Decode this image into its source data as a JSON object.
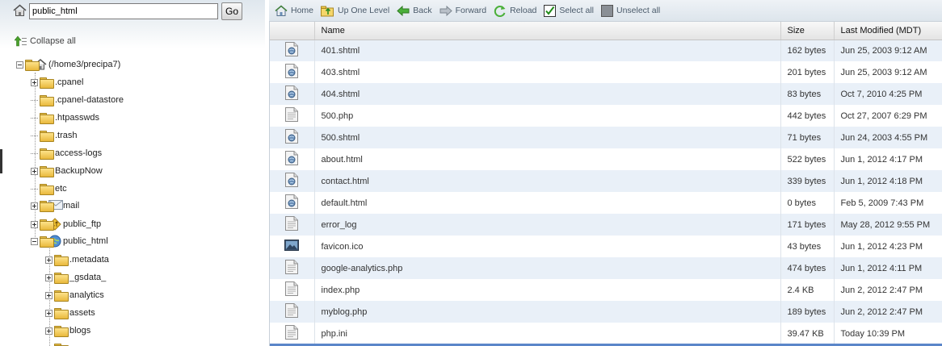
{
  "path_bar": {
    "value": "public_html",
    "go_label": "Go"
  },
  "tree": {
    "collapse_all": "Collapse all",
    "root": "(/home3/precipa7)",
    "items": [
      {
        "label": ".cpanel",
        "icon": "folder-icon",
        "expander": "plus"
      },
      {
        "label": ".cpanel-datastore",
        "icon": "folder-icon",
        "expander": "none"
      },
      {
        "label": ".htpasswds",
        "icon": "folder-icon",
        "expander": "none"
      },
      {
        "label": ".trash",
        "icon": "folder-icon",
        "expander": "none"
      },
      {
        "label": "access-logs",
        "icon": "folder-icon",
        "expander": "none"
      },
      {
        "label": "BackupNow",
        "icon": "folder-icon",
        "expander": "plus"
      },
      {
        "label": "etc",
        "icon": "folder-icon",
        "expander": "none"
      },
      {
        "label": "mail",
        "icon": "mail-folder-icon",
        "expander": "plus"
      },
      {
        "label": "public_ftp",
        "icon": "ftp-folder-icon",
        "expander": "plus"
      },
      {
        "label": "public_html",
        "icon": "web-folder-icon",
        "expander": "minus"
      }
    ],
    "sub_items": [
      {
        "label": ".metadata",
        "icon": "folder-icon",
        "expander": "plus"
      },
      {
        "label": "_gsdata_",
        "icon": "folder-icon",
        "expander": "plus"
      },
      {
        "label": "analytics",
        "icon": "folder-icon",
        "expander": "plus"
      },
      {
        "label": "assets",
        "icon": "folder-icon",
        "expander": "plus"
      },
      {
        "label": "blogs",
        "icon": "folder-icon",
        "expander": "plus"
      }
    ]
  },
  "toolbar": {
    "home": "Home",
    "up_one_level": "Up One Level",
    "back": "Back",
    "forward": "Forward",
    "reload": "Reload",
    "select_all": "Select all",
    "unselect_all": "Unselect all"
  },
  "file_table": {
    "columns": [
      "Name",
      "Size",
      "Last Modified (MDT)"
    ],
    "rows": [
      {
        "icon": "html-file-icon",
        "name": "401.shtml",
        "size": "162 bytes",
        "modified": "Jun 25, 2003 9:12 AM"
      },
      {
        "icon": "html-file-icon",
        "name": "403.shtml",
        "size": "201 bytes",
        "modified": "Jun 25, 2003 9:12 AM"
      },
      {
        "icon": "html-file-icon",
        "name": "404.shtml",
        "size": "83 bytes",
        "modified": "Oct 7, 2010 4:25 PM"
      },
      {
        "icon": "text-file-icon",
        "name": "500.php",
        "size": "442 bytes",
        "modified": "Oct 27, 2007 6:29 PM"
      },
      {
        "icon": "html-file-icon",
        "name": "500.shtml",
        "size": "71 bytes",
        "modified": "Jun 24, 2003 4:55 PM"
      },
      {
        "icon": "html-file-icon",
        "name": "about.html",
        "size": "522 bytes",
        "modified": "Jun 1, 2012 4:17 PM"
      },
      {
        "icon": "html-file-icon",
        "name": "contact.html",
        "size": "339 bytes",
        "modified": "Jun 1, 2012 4:18 PM"
      },
      {
        "icon": "html-file-icon",
        "name": "default.html",
        "size": "0 bytes",
        "modified": "Feb 5, 2009 7:43 PM"
      },
      {
        "icon": "text-file-icon",
        "name": "error_log",
        "size": "171 bytes",
        "modified": "May 28, 2012 9:55 PM"
      },
      {
        "icon": "image-file-icon",
        "name": "favicon.ico",
        "size": "43 bytes",
        "modified": "Jun 1, 2012 4:23 PM"
      },
      {
        "icon": "text-file-icon",
        "name": "google-analytics.php",
        "size": "474 bytes",
        "modified": "Jun 1, 2012 4:11 PM"
      },
      {
        "icon": "text-file-icon",
        "name": "index.php",
        "size": "2.4 KB",
        "modified": "Jun 2, 2012 2:47 PM"
      },
      {
        "icon": "text-file-icon",
        "name": "myblog.php",
        "size": "189 bytes",
        "modified": "Jun 2, 2012 2:47 PM"
      },
      {
        "icon": "text-file-icon",
        "name": "php.ini",
        "size": "39.47 KB",
        "modified": "Today 10:39 PM"
      }
    ]
  }
}
